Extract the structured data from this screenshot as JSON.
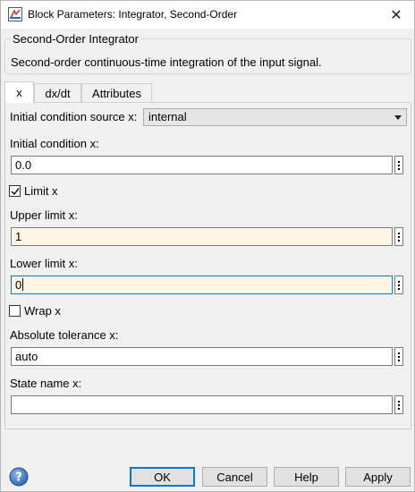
{
  "window": {
    "title": "Block Parameters: Integrator, Second-Order"
  },
  "group": {
    "legend": "Second-Order Integrator",
    "description": "Second-order continuous-time integration of the input signal."
  },
  "tabs": [
    {
      "label": "x",
      "active": true
    },
    {
      "label": "dx/dt",
      "active": false
    },
    {
      "label": "Attributes",
      "active": false
    }
  ],
  "params": {
    "ic_source_label": "Initial condition source x:",
    "ic_source_value": "internal",
    "ic_label": "Initial condition x:",
    "ic_value": "0.0",
    "limit_label": "Limit x",
    "limit_checked": true,
    "upper_label": "Upper limit x:",
    "upper_value": "1",
    "lower_label": "Lower limit x:",
    "lower_value": "0",
    "wrap_label": "Wrap x",
    "wrap_checked": false,
    "abstol_label": "Absolute tolerance x:",
    "abstol_value": "auto",
    "state_label": "State name x:",
    "state_value": ""
  },
  "buttons": {
    "ok": "OK",
    "cancel": "Cancel",
    "help": "Help",
    "apply": "Apply"
  },
  "colors": {
    "accent": "#0078d7",
    "tinted_field": "#fdf4e4"
  }
}
